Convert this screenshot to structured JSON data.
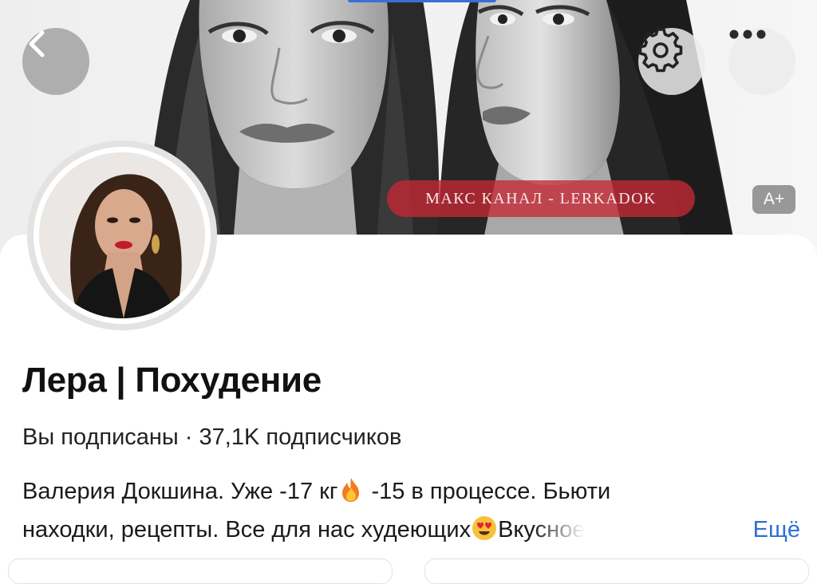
{
  "cover": {
    "channel_label": "МАКС КАНАЛ - LERKADOK",
    "font_badge": "A+"
  },
  "toolbar": {
    "back_icon": "chevron-left-icon",
    "settings_icon": "gear-icon",
    "more_icon": "more-dots-icon"
  },
  "profile": {
    "title": "Лера | Похудение",
    "subscribed_status": "Вы подписаны",
    "separator": " · ",
    "subscribers": "37,1K подписчиков",
    "description_line1_a": "Валерия Докшина. Уже  -17 кг",
    "description_line1_b": " -15 в процессе. Бьюти",
    "description_line2_a": "находки, рецепты. Все для нас худеющих",
    "description_line2_b": "Вкусное",
    "more_label": "Ещё",
    "emojis": [
      "fire-emoji",
      "heart-eyes-emoji"
    ]
  },
  "colors": {
    "accent_link": "#2f6fd6",
    "label_red": "#c42834",
    "top_progress": "#3a6fd8"
  }
}
